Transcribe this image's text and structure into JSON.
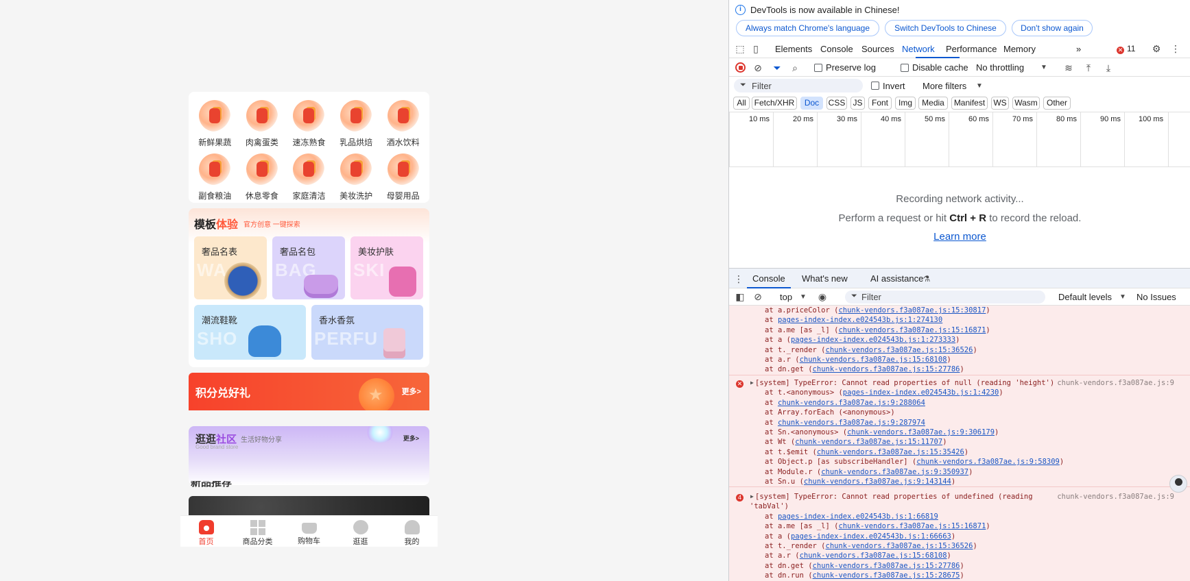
{
  "app": {
    "categories": [
      {
        "label": "新鲜果蔬"
      },
      {
        "label": "肉禽蛋类"
      },
      {
        "label": "速冻熟食"
      },
      {
        "label": "乳品烘焙"
      },
      {
        "label": "酒水饮料"
      },
      {
        "label": "副食粮油"
      },
      {
        "label": "休息零食"
      },
      {
        "label": "家庭清洁"
      },
      {
        "label": "美妆洗护"
      },
      {
        "label": "母婴用品"
      }
    ],
    "template": {
      "title_a": "模板",
      "title_b": "体验",
      "subtitle": "官方创意 一键探索",
      "tiles": [
        {
          "label": "奢品名表",
          "bg_text": "WA"
        },
        {
          "label": "奢品名包",
          "bg_text": "BAG"
        },
        {
          "label": "美妆护肤",
          "bg_text": "SKI"
        },
        {
          "label": "潮流鞋靴",
          "bg_text": "SHO"
        },
        {
          "label": "香水香氛",
          "bg_text": "PERFU"
        }
      ]
    },
    "points": {
      "title": "积分兑好礼",
      "more": "更多>"
    },
    "community": {
      "title_a": "逛逛",
      "title_b": "社区",
      "subtitle": "生活好物分享",
      "english": "Good brand store",
      "more": "更多>"
    },
    "cut_title": "新品推荐",
    "tabbar": [
      {
        "label": "首页",
        "icon": "home-icon",
        "active": true
      },
      {
        "label": "商品分类",
        "icon": "category-grid-icon",
        "active": false
      },
      {
        "label": "购物车",
        "icon": "cart-icon",
        "active": false
      },
      {
        "label": "逛逛",
        "icon": "planet-icon",
        "active": false
      },
      {
        "label": "我的",
        "icon": "user-icon",
        "active": false
      }
    ],
    "accent_color": "#f03c2d"
  },
  "devtools": {
    "infobar": {
      "message": "DevTools is now available in Chinese!",
      "btn_match": "Always match Chrome's language",
      "btn_switch": "Switch DevTools to Chinese",
      "btn_dismiss": "Don't show again"
    },
    "tabs": [
      "Elements",
      "Console",
      "Sources",
      "Network",
      "Performance",
      "Memory"
    ],
    "active_tab": "Network",
    "overflow": "»",
    "error_count": "11",
    "network_toolbar": {
      "preserve_log": "Preserve log",
      "disable_cache": "Disable cache",
      "throttling": "No throttling"
    },
    "filter": {
      "placeholder": "Filter",
      "invert": "Invert",
      "more_filters": "More filters"
    },
    "type_filters": [
      "All",
      "Fetch/XHR",
      "Doc",
      "CSS",
      "JS",
      "Font",
      "Img",
      "Media",
      "Manifest",
      "WS",
      "Wasm",
      "Other"
    ],
    "active_type": "Doc",
    "timeline_ticks": [
      "10 ms",
      "20 ms",
      "30 ms",
      "40 ms",
      "50 ms",
      "60 ms",
      "70 ms",
      "80 ms",
      "90 ms",
      "100 ms"
    ],
    "empty_state": {
      "line1": "Recording network activity...",
      "line2_pre": "Perform a request or hit ",
      "line2_key": "Ctrl + R",
      "line2_post": " to record the reload.",
      "link": "Learn more"
    },
    "drawer_tabs": [
      "Console",
      "What's new",
      "AI assistance"
    ],
    "console_toolbar": {
      "context": "top",
      "filter_placeholder": "Filter",
      "levels": "Default levels",
      "issues": "No Issues"
    },
    "console_messages": [
      {
        "lines": [
          {
            "pre": "at a.priceColor (",
            "link": "chunk-vendors.f3a087ae.js:15:30817",
            "post": ")"
          },
          {
            "pre": "at ",
            "link": "pages-index-index.e024543b.js:1:274130",
            "post": ""
          },
          {
            "pre": "at a.me [as _l] (",
            "link": "chunk-vendors.f3a087ae.js:15:16871",
            "post": ")"
          },
          {
            "pre": "at a (",
            "link": "pages-index-index.e024543b.js:1:273333",
            "post": ")"
          },
          {
            "pre": "at t._render (",
            "link": "chunk-vendors.f3a087ae.js:15:36526",
            "post": ")"
          },
          {
            "pre": "at a.r (",
            "link": "chunk-vendors.f3a087ae.js:15:68108",
            "post": ")"
          },
          {
            "pre": "at dn.get (",
            "link": "chunk-vendors.f3a087ae.js:15:27786",
            "post": ")"
          }
        ]
      },
      {
        "badge": "",
        "header": "[system] TypeError: Cannot read properties of null (reading 'height')",
        "source": "chunk-vendors.f3a087ae.js:9",
        "lines": [
          {
            "pre": "at t.<anonymous> (",
            "link": "pages-index-index.e024543b.js:1:4230",
            "post": ")"
          },
          {
            "pre": "at ",
            "link": "chunk-vendors.f3a087ae.js:9:288064",
            "post": ""
          },
          {
            "pre": "at Array.forEach (<anonymous>)",
            "link": "",
            "post": ""
          },
          {
            "pre": "at ",
            "link": "chunk-vendors.f3a087ae.js:9:287974",
            "post": ""
          },
          {
            "pre": "at Sn.<anonymous> (",
            "link": "chunk-vendors.f3a087ae.js:9:306179",
            "post": ")"
          },
          {
            "pre": "at Wt (",
            "link": "chunk-vendors.f3a087ae.js:15:11707",
            "post": ")"
          },
          {
            "pre": "at t.$emit (",
            "link": "chunk-vendors.f3a087ae.js:15:35426",
            "post": ")"
          },
          {
            "pre": "at Object.p [as subscribeHandler] (",
            "link": "chunk-vendors.f3a087ae.js:9:58309",
            "post": ")"
          },
          {
            "pre": "at Module.r (",
            "link": "chunk-vendors.f3a087ae.js:9:350937",
            "post": ")"
          },
          {
            "pre": "at Sn.u (",
            "link": "chunk-vendors.f3a087ae.js:9:143144",
            "post": ")"
          }
        ]
      },
      {
        "badge": "4",
        "header": "[system] TypeError: Cannot read properties of undefined (reading",
        "header2": "'tabVal')",
        "source": "chunk-vendors.f3a087ae.js:9",
        "lines": [
          {
            "pre": "at ",
            "link": "pages-index-index.e024543b.js:1:66819",
            "post": ""
          },
          {
            "pre": "at a.me [as _l] (",
            "link": "chunk-vendors.f3a087ae.js:15:16871",
            "post": ")"
          },
          {
            "pre": "at a (",
            "link": "pages-index-index.e024543b.js:1:66663",
            "post": ")"
          },
          {
            "pre": "at t._render (",
            "link": "chunk-vendors.f3a087ae.js:15:36526",
            "post": ")"
          },
          {
            "pre": "at a.r (",
            "link": "chunk-vendors.f3a087ae.js:15:68108",
            "post": ")"
          },
          {
            "pre": "at dn.get (",
            "link": "chunk-vendors.f3a087ae.js:15:27786",
            "post": ")"
          },
          {
            "pre": "at dn.run (",
            "link": "chunk-vendors.f3a087ae.js:15:28675",
            "post": ")"
          }
        ]
      }
    ]
  }
}
